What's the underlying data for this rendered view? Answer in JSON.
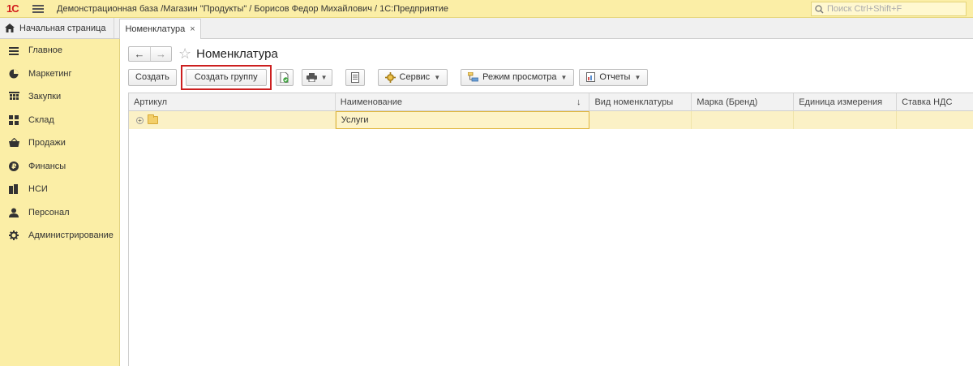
{
  "app": {
    "logo": "1С",
    "title": "Демонстрационная база /Магазин \"Продукты\" / Борисов Федор Михайлович / 1С:Предприятие",
    "search_placeholder": "Поиск Ctrl+Shift+F"
  },
  "tabs": {
    "home_label": "Начальная страница",
    "doc_label": "Номенклатура",
    "close_glyph": "×"
  },
  "sidebar": {
    "items": [
      {
        "label": "Главное",
        "icon": "menu-lines-icon"
      },
      {
        "label": "Маркетинг",
        "icon": "pie-chart-icon"
      },
      {
        "label": "Закупки",
        "icon": "purchase-icon"
      },
      {
        "label": "Склад",
        "icon": "warehouse-grid-icon"
      },
      {
        "label": "Продажи",
        "icon": "basket-icon"
      },
      {
        "label": "Финансы",
        "icon": "ruble-coin-icon"
      },
      {
        "label": "НСИ",
        "icon": "books-icon"
      },
      {
        "label": "Персонал",
        "icon": "person-icon"
      },
      {
        "label": "Администрирование",
        "icon": "gear-icon"
      }
    ]
  },
  "page": {
    "title": "Номенклатура",
    "back_glyph": "←",
    "forward_glyph": "→",
    "star_glyph": "☆"
  },
  "toolbar": {
    "create_label": "Создать",
    "create_group_label": "Создать группу",
    "service_label": "Сервис",
    "view_mode_label": "Режим просмотра",
    "reports_label": "Отчеты"
  },
  "table": {
    "columns": [
      "Артикул",
      "Наименование",
      "Вид номенклатуры",
      "Марка (Бренд)",
      "Единица измерения",
      "Ставка НДС"
    ],
    "sort_glyph": "↓",
    "rows": [
      {
        "article": "",
        "name": "Услуги",
        "kind": "",
        "brand": "",
        "unit": "",
        "vat": ""
      }
    ]
  },
  "colors": {
    "panel_yellow": "#fbeea6",
    "highlight_red": "#cc1f1f",
    "selected_row": "#fbf1c6"
  }
}
